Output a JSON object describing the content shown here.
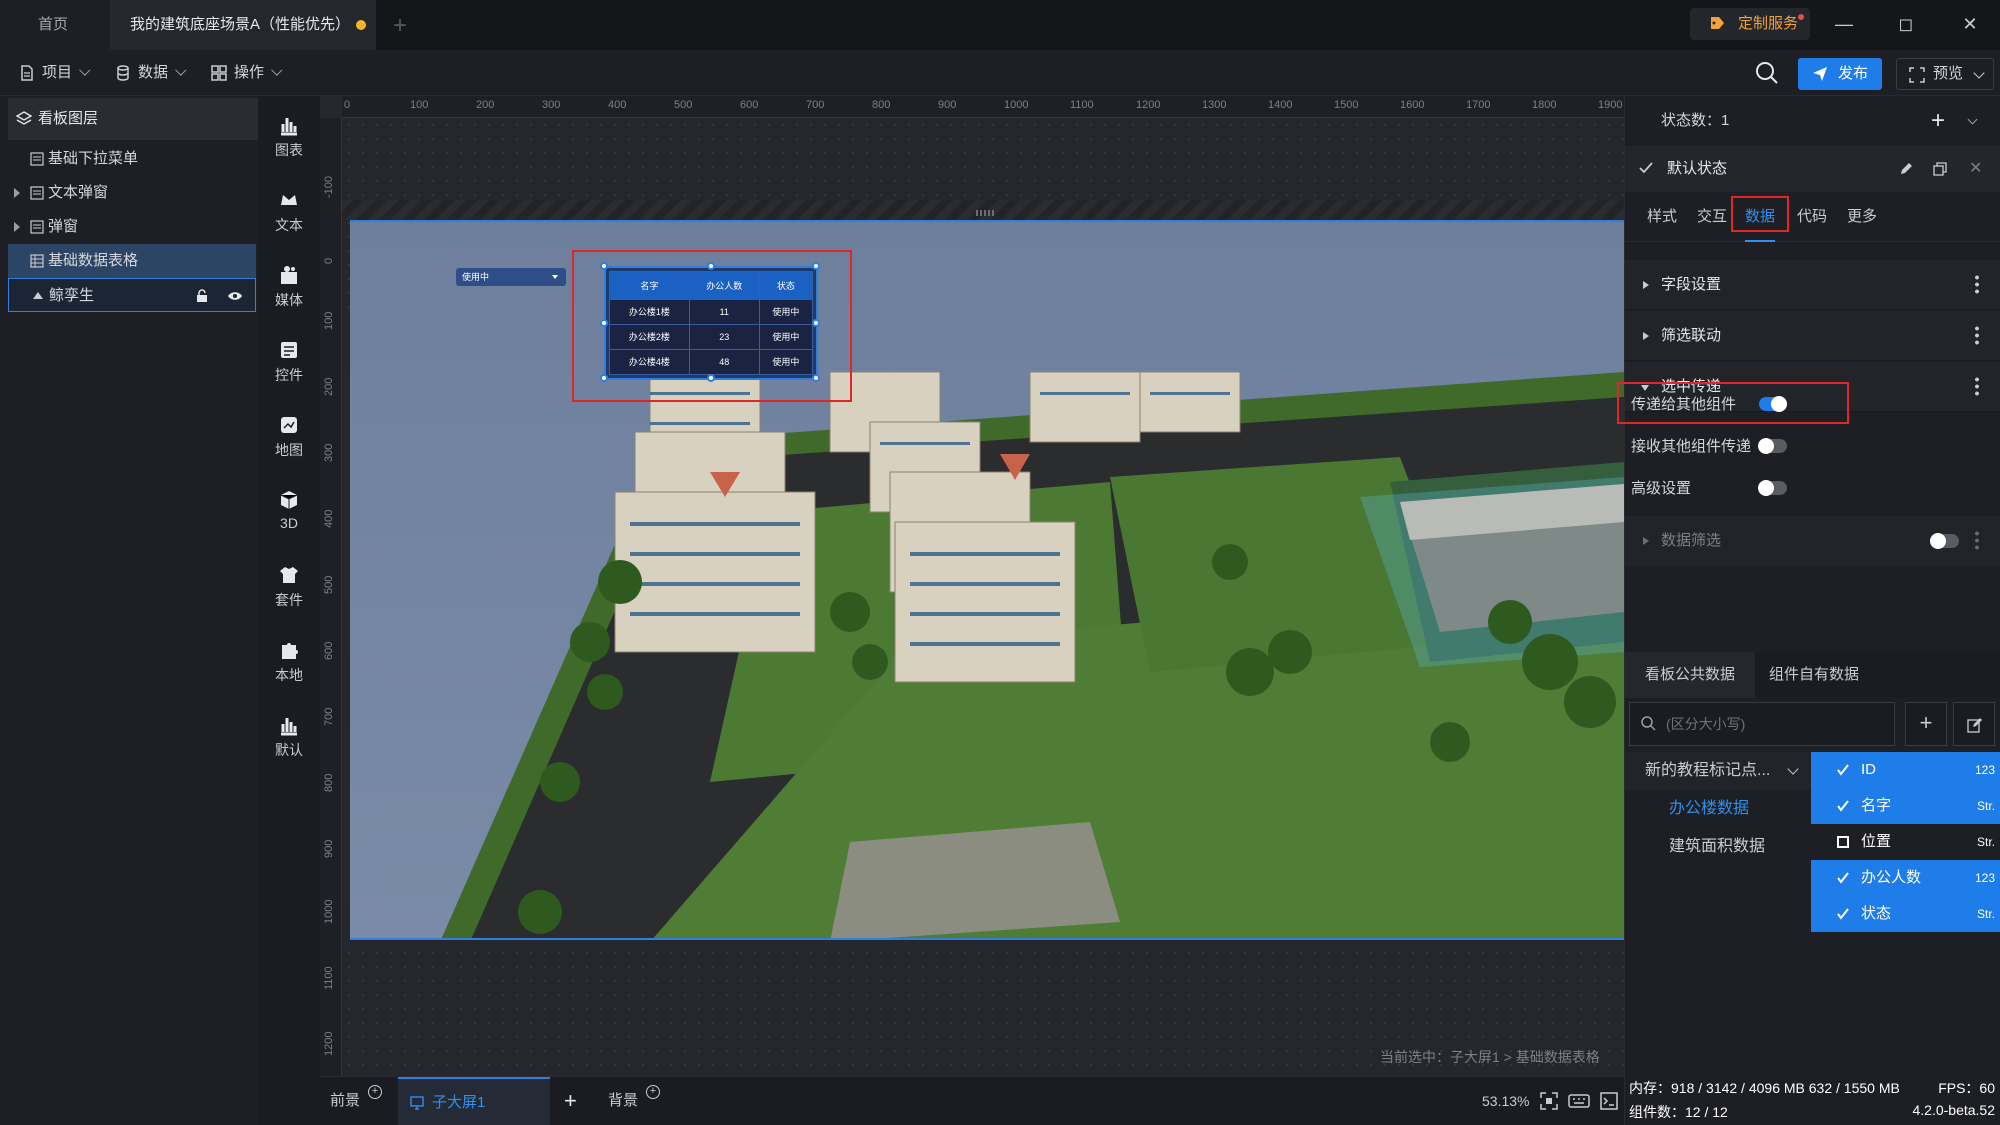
{
  "titlebar": {
    "home_tab": "首页",
    "active_tab": "我的建筑底座场景A（性能优先）",
    "custom_service": "定制服务"
  },
  "toolbar": {
    "project": "项目",
    "data": "数据",
    "operate": "操作",
    "publish": "发布",
    "preview": "预览"
  },
  "layers": {
    "title": "看板图层",
    "items": [
      {
        "label": "基础下拉菜单"
      },
      {
        "label": "文本弹窗"
      },
      {
        "label": "弹窗"
      },
      {
        "label": "基础数据表格"
      },
      {
        "label": "鲸孪生"
      }
    ]
  },
  "components": [
    {
      "label": "图表"
    },
    {
      "label": "文本"
    },
    {
      "label": "媒体"
    },
    {
      "label": "控件"
    },
    {
      "label": "地图"
    },
    {
      "label": "3D"
    },
    {
      "label": "套件"
    },
    {
      "label": "本地"
    },
    {
      "label": "默认"
    }
  ],
  "ruler": {
    "top": [
      "0",
      "100",
      "200",
      "300",
      "400",
      "500",
      "600",
      "700",
      "800",
      "900",
      "1000",
      "1100",
      "1200",
      "1300",
      "1400",
      "1500",
      "1600",
      "1700",
      "1800",
      "1900"
    ],
    "left": [
      "-100",
      "0",
      "100",
      "200",
      "300",
      "400",
      "500",
      "600",
      "700",
      "800",
      "900",
      "1000",
      "1100",
      "1200"
    ]
  },
  "widget": {
    "dropdown_value": "使用中",
    "headers": [
      "名字",
      "办公人数",
      "状态"
    ],
    "rows": [
      [
        "办公楼1楼",
        "11",
        "使用中"
      ],
      [
        "办公楼2楼",
        "23",
        "使用中"
      ],
      [
        "办公楼4楼",
        "48",
        "使用中"
      ]
    ]
  },
  "canvas": {
    "selection_note": "当前选中：子大屏1 > 基础数据表格"
  },
  "bottombar": {
    "front": "前景",
    "sub_screen": "子大屏1",
    "background": "背景",
    "zoom": "53.13%"
  },
  "rpanel": {
    "state_count": "状态数：1",
    "default_state": "默认状态",
    "tabs": [
      "样式",
      "交互",
      "数据",
      "代码",
      "更多"
    ],
    "sections": {
      "field_settings": "字段设置",
      "filter_link": "筛选联动",
      "selection_pass": "选中传递",
      "data_filter": "数据筛选"
    },
    "toggles": {
      "pass_to_others": "传递给其他组件",
      "receive_from_others": "接收其他组件传递",
      "advanced": "高级设置"
    },
    "data_tabs": {
      "public": "看板公共数据",
      "own": "组件自有数据"
    },
    "search_placeholder": "(区分大小写)",
    "datasets": [
      "新的教程标记点...",
      "办公楼数据",
      "建筑面积数据"
    ],
    "fields": [
      {
        "name": "ID",
        "type": "123",
        "checked": true
      },
      {
        "name": "名字",
        "type": "Str.",
        "checked": true
      },
      {
        "name": "位置",
        "type": "Str.",
        "checked": false
      },
      {
        "name": "办公人数",
        "type": "123",
        "checked": true
      },
      {
        "name": "状态",
        "type": "Str.",
        "checked": true
      }
    ]
  },
  "status": {
    "memory": "内存：918 / 3142 / 4096 MB  632 / 1550 MB",
    "fps": "FPS：60",
    "components": "组件数：12 / 12",
    "version": "4.2.0-beta.52"
  }
}
